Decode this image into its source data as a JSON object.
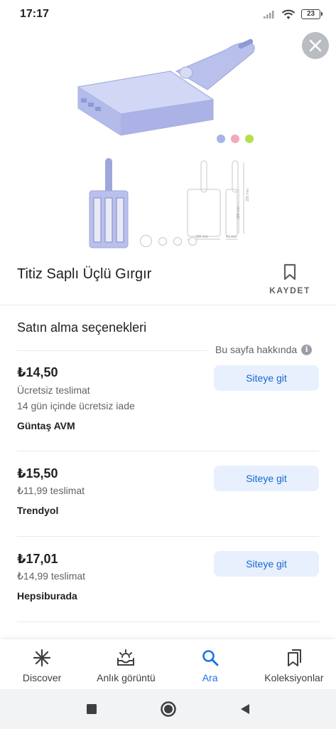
{
  "status_bar": {
    "time": "17:17",
    "battery": "23"
  },
  "product": {
    "title": "Titiz Saplı Üçlü Gırgır",
    "save_label": "KAYDET",
    "color_options": [
      "#a8b3e6",
      "#f2a9b8",
      "#b6e04a"
    ],
    "image_count": 4
  },
  "dimensions": {
    "a": "185 mm",
    "b": "41 mm",
    "c": "185 mm",
    "d": "250 mm"
  },
  "purchase": {
    "section_title": "Satın alma seçenekleri",
    "about_page": "Bu sayfa hakkında",
    "offers": [
      {
        "price": "₺14,50",
        "lines": [
          "Ücretsiz teslimat",
          "14 gün içinde ücretsiz iade"
        ],
        "seller": "Güntaş AVM",
        "button": "Siteye git"
      },
      {
        "price": "₺15,50",
        "lines": [
          "₺11,99 teslimat"
        ],
        "seller": "Trendyol",
        "button": "Siteye git"
      },
      {
        "price": "₺17,01",
        "lines": [
          "₺14,99 teslimat"
        ],
        "seller": "Hepsiburada",
        "button": "Siteye git"
      }
    ]
  },
  "bottom_nav": [
    {
      "label": "Discover",
      "icon": "asterisk-icon",
      "active": false
    },
    {
      "label": "Anlık görüntü",
      "icon": "sunrise-inbox-icon",
      "active": false
    },
    {
      "label": "Ara",
      "icon": "search-icon",
      "active": true
    },
    {
      "label": "Koleksiyonlar",
      "icon": "collections-icon",
      "active": false
    }
  ],
  "colors": {
    "accent": "#1a73e8",
    "button_bg": "#e8f0fe",
    "product": "#b9c0ec"
  }
}
